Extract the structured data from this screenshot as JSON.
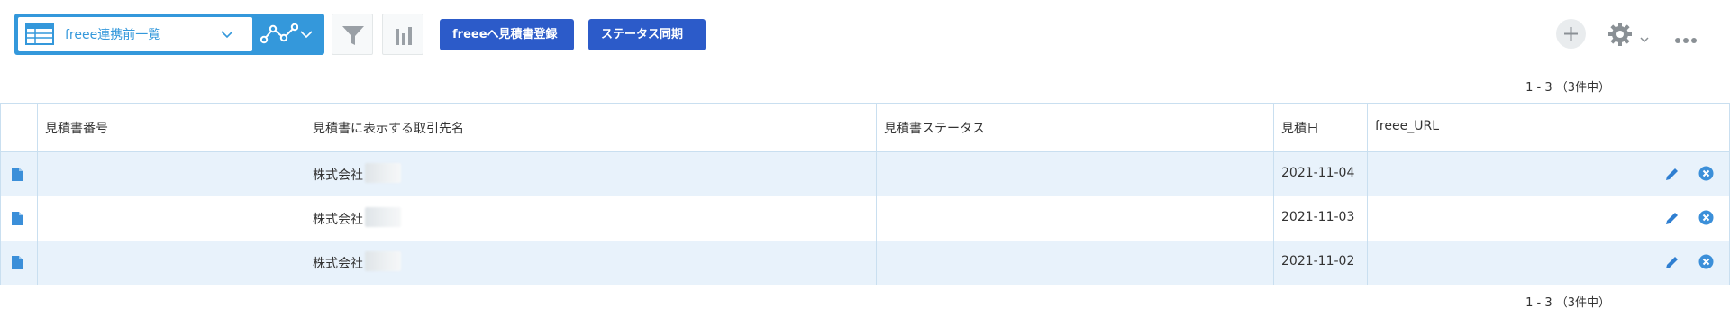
{
  "toolbar": {
    "view_name": "freee連携前一覧",
    "freee_button": "freeeへ見積書登録",
    "sync_button": "ステータス同期"
  },
  "pagination": {
    "top": "1 - 3 （3件中）",
    "bottom": "1 - 3 （3件中）"
  },
  "table": {
    "columns": [
      "見積書番号",
      "見積書に表示する取引先名",
      "見積書ステータス",
      "見積日",
      "freee_URL"
    ],
    "rows": [
      {
        "number": "",
        "client": "株式会社",
        "status": "",
        "date": "2021-11-04",
        "url": ""
      },
      {
        "number": "",
        "client": "株式会社",
        "status": "",
        "date": "2021-11-03",
        "url": ""
      },
      {
        "number": "",
        "client": "株式会社",
        "status": "",
        "date": "2021-11-02",
        "url": ""
      }
    ]
  },
  "colors": {
    "accent": "#3498db",
    "button": "#2c5bc9",
    "row_alt": "#e8f2fb",
    "border": "#c9dff0"
  },
  "icons": [
    "table-icon",
    "chevron-down-icon",
    "graph-icon",
    "filter-icon",
    "bar-chart-icon",
    "plus-icon",
    "gear-icon",
    "more-icon",
    "document-icon",
    "pencil-icon",
    "delete-icon"
  ]
}
